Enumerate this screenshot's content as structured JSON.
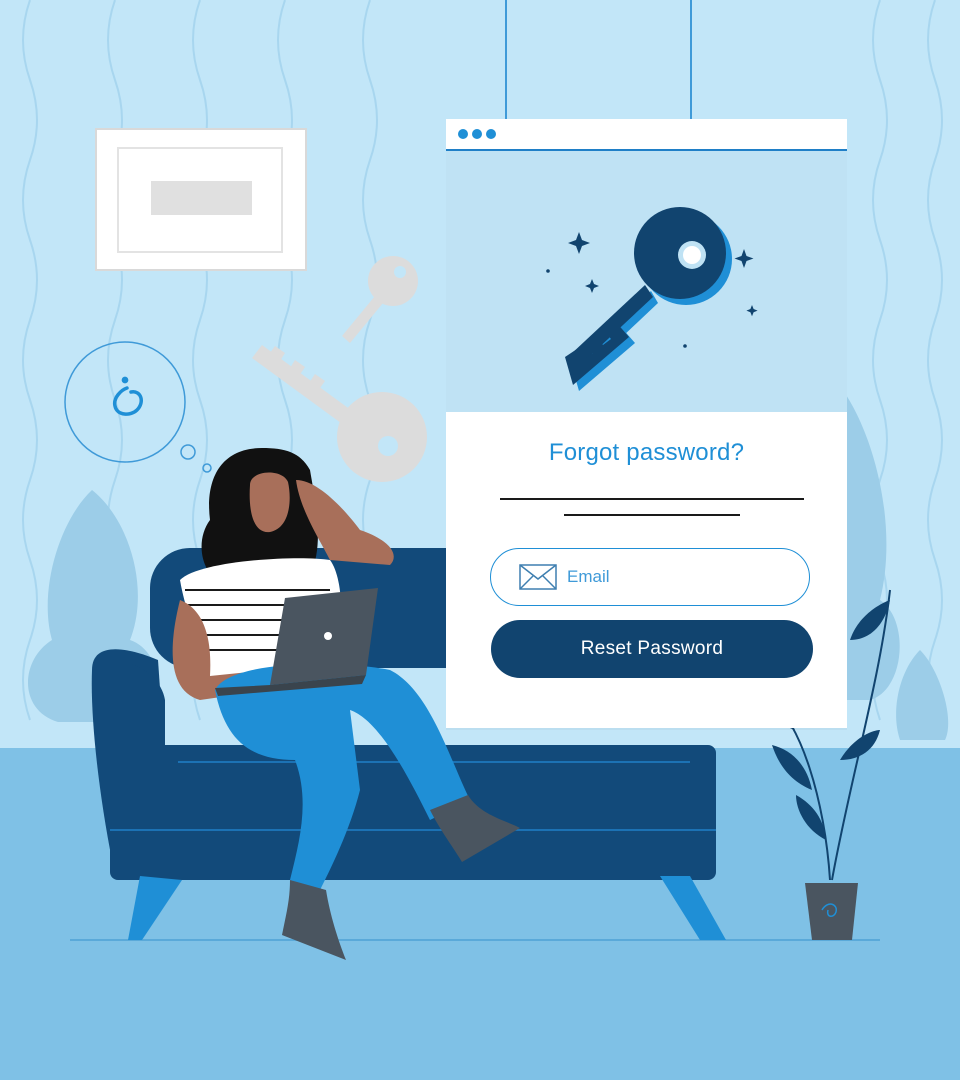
{
  "form": {
    "title": "Forgot password?",
    "email_placeholder": "Email",
    "reset_label": "Reset Password"
  },
  "icons": [
    "mail-icon",
    "key-icon",
    "question-mark-icon",
    "laptop-icon",
    "sparkle-icon"
  ],
  "colors": {
    "wall": "#c2e6f8",
    "floor": "#7fc1e6",
    "accent_blue": "#1f8fd6",
    "navy": "#11446f",
    "panel_hero": "#bfe2f4",
    "white": "#ffffff"
  }
}
